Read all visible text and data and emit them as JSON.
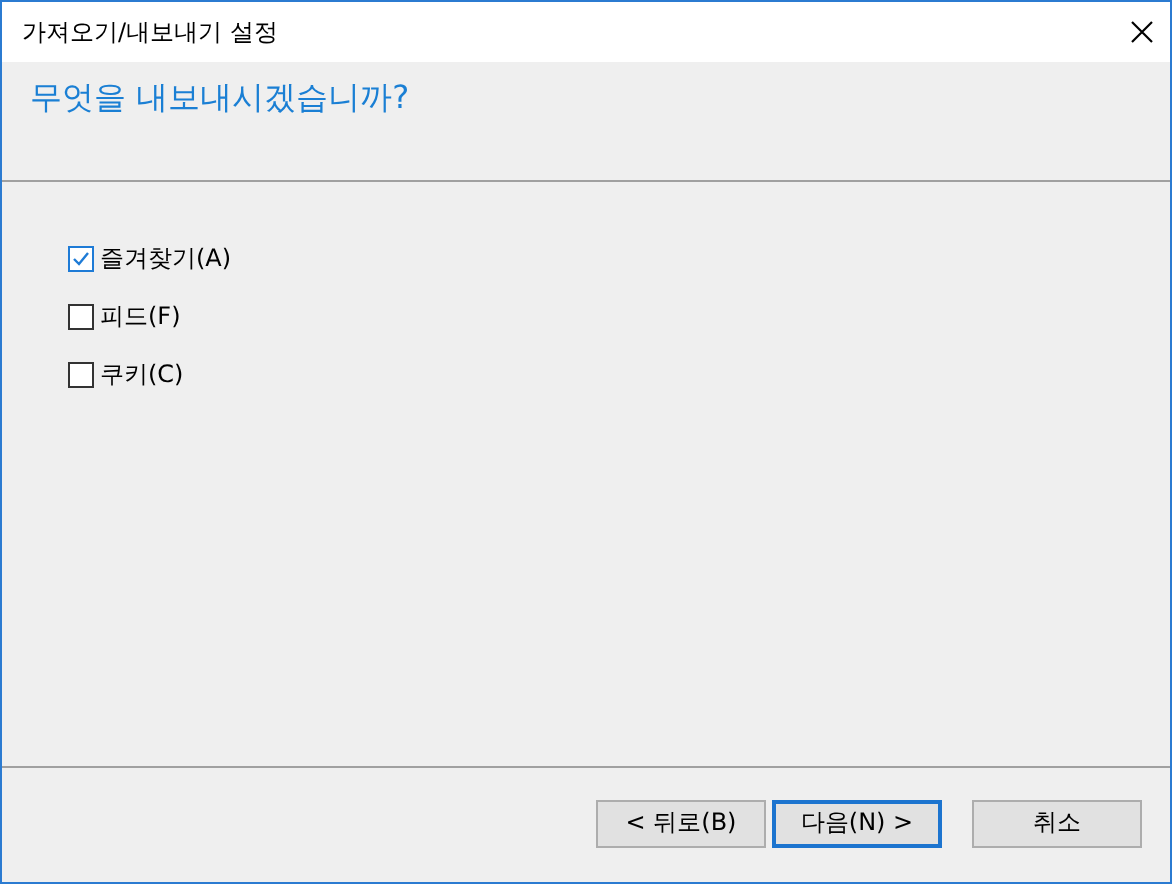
{
  "window": {
    "title": "가져오기/내보내기 설정"
  },
  "heading": "무엇을 내보내시겠습니까?",
  "options": [
    {
      "label": "즐겨찾기(A)",
      "checked": true
    },
    {
      "label": "피드(F)",
      "checked": false
    },
    {
      "label": "쿠키(C)",
      "checked": false
    }
  ],
  "buttons": [
    {
      "label": "< 뒤로(B)",
      "default": false
    },
    {
      "label": "다음(N) >",
      "default": true
    },
    {
      "label": "취소",
      "default": false
    }
  ]
}
